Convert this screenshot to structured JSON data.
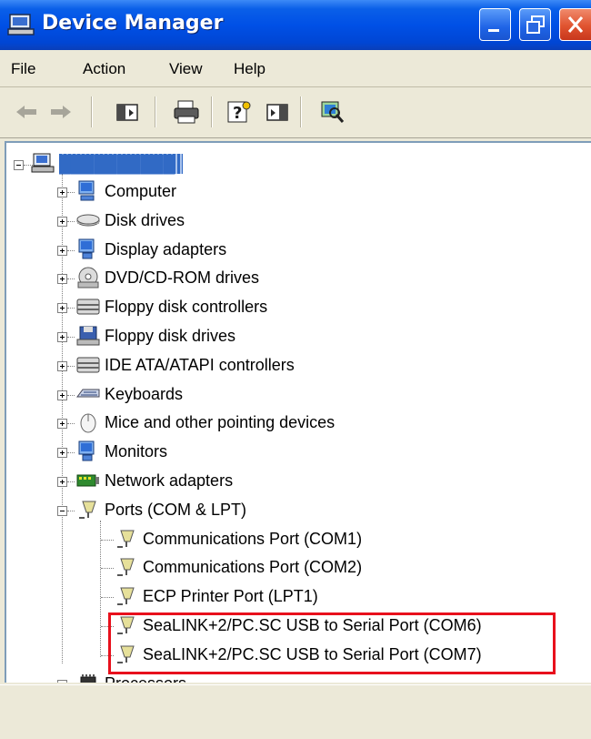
{
  "window": {
    "title": "Device Manager",
    "buttons": {
      "minimize": "minimize",
      "maximize": "maximize",
      "close": "close"
    }
  },
  "menu": [
    "File",
    "Action",
    "View",
    "Help"
  ],
  "toolbar": {
    "items": [
      "back-icon",
      "forward-icon",
      "show-hide-console-tree-icon",
      "print-icon",
      "help-icon",
      "show-hide-action-pane-icon",
      "scan-hardware-icon"
    ]
  },
  "tree": {
    "root_label": "██████████",
    "categories": [
      "Computer",
      "Disk drives",
      "Display adapters",
      "DVD/CD-ROM drives",
      "Floppy disk controllers",
      "Floppy disk drives",
      "IDE ATA/ATAPI controllers",
      "Keyboards",
      "Mice and other pointing devices",
      "Monitors",
      "Network adapters",
      "Ports (COM & LPT)"
    ],
    "ports": [
      "Communications Port (COM1)",
      "Communications Port (COM2)",
      "ECP Printer Port (LPT1)",
      "SeaLINK+2/PC.SC USB to Serial Port (COM6)",
      "SeaLINK+2/PC.SC USB to Serial Port (COM7)"
    ],
    "after": [
      "Processors"
    ]
  },
  "colors": {
    "highlight_border": "#e8101c",
    "title_bar": "#0050e6",
    "selection": "#316ac5"
  }
}
